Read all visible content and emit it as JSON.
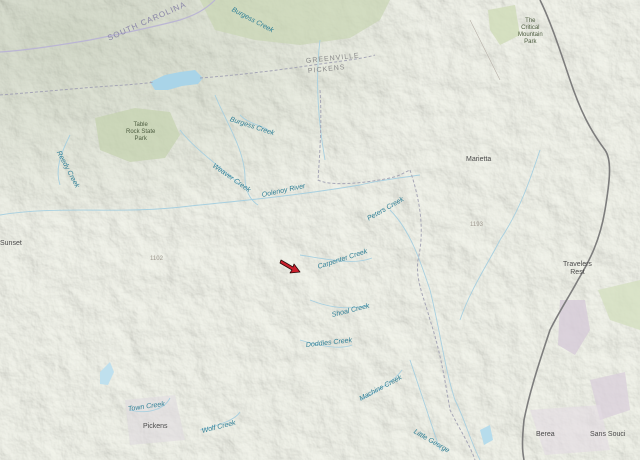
{
  "map": {
    "states": {
      "south_carolina": "SOUTH CAROLINA"
    },
    "counties": {
      "greenville": "GREENVILLE",
      "pickens": "PICKENS"
    },
    "parks": {
      "table_rock": [
        "Table",
        "Rock State",
        "Park"
      ],
      "critical_mountain": [
        "The",
        "Critical",
        "Mountain",
        "Park"
      ]
    },
    "streams": {
      "burgess_creek_top": "Burgess Creek",
      "burgess_creek": "Burgess Creek",
      "weaver_creek": "Weaver Creek",
      "oolenoy_river": "Oolenoy River",
      "peters_creek": "Peters Creek",
      "carpenter_creek": "Carpenter Creek",
      "shoal_creek": "Shoal Creek",
      "doddies_creek": "Doddies Creek",
      "machine_creek": "Machine Creek",
      "town_creek": "Town Creek",
      "wolf_creek": "Wolf Creek",
      "little_george": "Little George",
      "reedy_creek": "Reedy Creek"
    },
    "places": {
      "marietta": "Marietta",
      "travelers_rest": [
        "Travelers",
        "Rest"
      ],
      "pickens": "Pickens",
      "berea": "Berea",
      "sans_souci": "Sans Souci",
      "sunset": "Sunset",
      "1102": "1102",
      "1193": "1193"
    },
    "icons": {
      "marker": "arrow-marker-icon"
    },
    "colors": {
      "water": "#a9d4e8",
      "marker": "#cc1f2c",
      "road": "#808080",
      "urban": "#d6cbd8"
    }
  }
}
